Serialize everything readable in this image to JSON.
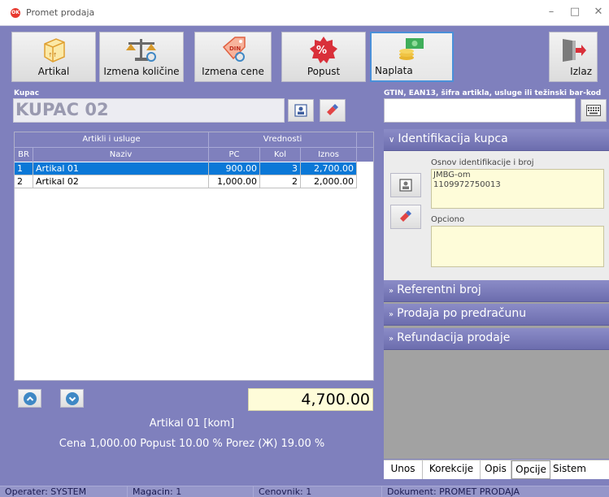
{
  "window": {
    "title": "Promet prodaja",
    "app_icon_text": "OK"
  },
  "toolbar": {
    "artikal": "Artikal",
    "izmena_kolicine": "Izmena količine",
    "izmena_cene": "Izmena cene",
    "popust": "Popust",
    "naplata": "Naplata",
    "izlaz": "Izlaz"
  },
  "customer": {
    "label": "Kupac",
    "name": "KUPAC 02"
  },
  "gtin": {
    "label": "GTIN, EAN13, šifra artikla, usluge ili težinski bar-kod",
    "value": ""
  },
  "table": {
    "group_headers": [
      "Artikli i usluge",
      "Vrednosti"
    ],
    "columns": [
      "BR",
      "Naziv",
      "PC",
      "Kol",
      "Iznos"
    ],
    "rows": [
      {
        "br": "1",
        "naziv": "Artikal 01",
        "pc": "900.00",
        "kol": "3",
        "iznos": "2,700.00",
        "selected": true
      },
      {
        "br": "2",
        "naziv": "Artikal 02",
        "pc": "1,000.00",
        "kol": "2",
        "iznos": "2,000.00",
        "selected": false
      }
    ]
  },
  "total": "4,700.00",
  "item_info": {
    "line1": "Artikal 01 [kom]",
    "line2": "Cena 1,000.00  Popust 10.00 %  Porez  (Ж) 19.00 %"
  },
  "right_panel": {
    "identifikacija": {
      "header": "Identifikacija kupca",
      "osnov_label": "Osnov identifikacije i broj",
      "osnov_line1": "JMBG-om",
      "osnov_line2": "1109972750013",
      "opciono_label": "Opciono",
      "opciono_value": ""
    },
    "referentni_broj": "Referentni broj",
    "prodaja_po_predracunu": "Prodaja po predračunu",
    "refundacija_prodaje": "Refundacija prodaje"
  },
  "bottom_tabs": [
    "Unos",
    "Korekcije",
    "Opis",
    "Opcije",
    "Sistem"
  ],
  "bottom_tabs_active": "Opcije",
  "status": {
    "operater": "Operater: SYSTEM",
    "magacin": "Magacin: 1",
    "cenovnik": "Cenovnik: 1",
    "dokument": "Dokument: PROMET PRODAJA"
  },
  "colors": {
    "background": "#7f80bd",
    "selection": "#0b78d7",
    "total_bg": "#fefcd9",
    "panel_header": "#7576b7"
  }
}
